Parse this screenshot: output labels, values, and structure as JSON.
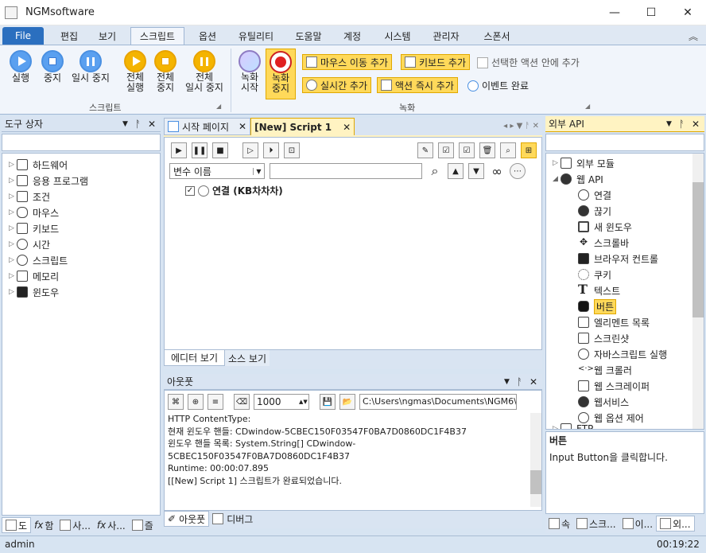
{
  "window": {
    "title": "NGMsoftware",
    "min": "—",
    "max": "☐",
    "close": "✕"
  },
  "menu": {
    "file": "File",
    "tabs": [
      "편집",
      "보기",
      "스크립트",
      "옵션",
      "유틸리티",
      "도움말",
      "계정",
      "시스템",
      "관리자",
      "스폰서"
    ],
    "active_index": 2,
    "collapse": "︽"
  },
  "ribbon": {
    "script_group": {
      "label": "스크립트",
      "run": "실행",
      "stop": "중지",
      "pause": "일시 중지",
      "run_all": "전체\n실행",
      "stop_all": "전체\n중지",
      "pause_all": "전체\n일시 중지"
    },
    "record_group": {
      "label": "녹화",
      "record_start": "녹화\n시작",
      "record_stop": "녹화\n중지",
      "mouse_move": "마우스 이동 추가",
      "keyboard_add": "키보드 추가",
      "in_selected": "선택한 액션 안에 추가",
      "realtime_add": "실시간 추가",
      "instant_add": "액션 즉시 추가",
      "event_done": "이벤트 완료"
    }
  },
  "toolbox": {
    "title": "도구 상자",
    "items": [
      "하드웨어",
      "응용 프로그램",
      "조건",
      "마우스",
      "키보드",
      "시간",
      "스크립트",
      "메모리",
      "윈도우"
    ],
    "bottom_tabs": [
      "도",
      "함",
      "사...",
      "사...",
      "즐"
    ]
  },
  "doc_tabs": {
    "start": "시작 페이지",
    "script": "[New] Script 1"
  },
  "editor": {
    "var_select": "변수 이름",
    "search_value": "",
    "tree_item": "연결 (KB차차차)",
    "view_tabs": [
      "에디터 보기",
      "소스 보기"
    ]
  },
  "output": {
    "title": "아웃풋",
    "count": "1000",
    "path": "C:\\Users\\ngmas\\Documents\\NGM6\\",
    "lines": [
      "HTTP ContentType:",
      "현재 윈도우 핸들: CDwindow-5CBEC150F03547F0BA7D0860DC1F4B37",
      "윈도우 핸들 목록: System.String[] CDwindow-",
      "5CBEC150F03547F0BA7D0860DC1F4B37",
      "Runtime: 00:00:07.895",
      "[[New] Script 1] 스크립트가 완료되었습니다."
    ],
    "bottom_tabs": [
      "아웃풋",
      "디버그"
    ]
  },
  "api": {
    "title": "외부 API",
    "items": [
      {
        "label": "외부 모듈",
        "level": 0,
        "arrow": "▷"
      },
      {
        "label": "웹 API",
        "level": 0,
        "arrow": "◢"
      },
      {
        "label": "연결",
        "level": 1
      },
      {
        "label": "끊기",
        "level": 1
      },
      {
        "label": "새 윈도우",
        "level": 1
      },
      {
        "label": "스크롤바",
        "level": 1
      },
      {
        "label": "브라우저 컨트롤",
        "level": 1
      },
      {
        "label": "쿠키",
        "level": 1
      },
      {
        "label": "텍스트",
        "level": 1
      },
      {
        "label": "버튼",
        "level": 1,
        "selected": true
      },
      {
        "label": "엘리멘트 목록",
        "level": 1
      },
      {
        "label": "스크린샷",
        "level": 1
      },
      {
        "label": "자바스크립트 실행",
        "level": 1
      },
      {
        "label": "웹 크롤러",
        "level": 1
      },
      {
        "label": "웹 스크레이퍼",
        "level": 1
      },
      {
        "label": "웹서비스",
        "level": 1
      },
      {
        "label": "웹 옵션 제어",
        "level": 1
      },
      {
        "label": "FTP",
        "level": 0,
        "arrow": "▷"
      }
    ],
    "desc_title": "버튼",
    "desc_text": "Input Button을 클릭합니다.",
    "bottom_tabs": [
      "속",
      "스크...",
      "이...",
      "외..."
    ]
  },
  "status": {
    "user": "admin",
    "time": "00:19:22"
  }
}
